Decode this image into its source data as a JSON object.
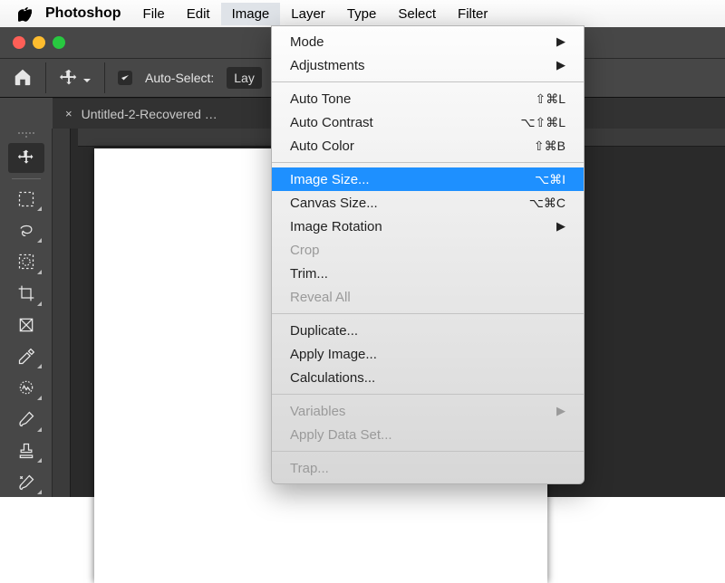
{
  "menubar": {
    "appname": "Photoshop",
    "items": [
      "File",
      "Edit",
      "Image",
      "Layer",
      "Type",
      "Select",
      "Filter"
    ],
    "open_index": 2
  },
  "toolbar": {
    "auto_select_label": "Auto-Select:",
    "layer_label": "Lay"
  },
  "tab": {
    "title": "Untitled-2-Recovered …"
  },
  "dropdown": {
    "groups": [
      [
        {
          "label": "Mode",
          "submenu": true
        },
        {
          "label": "Adjustments",
          "submenu": true
        }
      ],
      [
        {
          "label": "Auto Tone",
          "shortcut": "⇧⌘L"
        },
        {
          "label": "Auto Contrast",
          "shortcut": "⌥⇧⌘L"
        },
        {
          "label": "Auto Color",
          "shortcut": "⇧⌘B"
        }
      ],
      [
        {
          "label": "Image Size...",
          "shortcut": "⌥⌘I",
          "highlight": true
        },
        {
          "label": "Canvas Size...",
          "shortcut": "⌥⌘C"
        },
        {
          "label": "Image Rotation",
          "submenu": true
        },
        {
          "label": "Crop",
          "disabled": true
        },
        {
          "label": "Trim..."
        },
        {
          "label": "Reveal All",
          "disabled": true
        }
      ],
      [
        {
          "label": "Duplicate..."
        },
        {
          "label": "Apply Image..."
        },
        {
          "label": "Calculations..."
        }
      ],
      [
        {
          "label": "Variables",
          "submenu": true,
          "disabled": true
        },
        {
          "label": "Apply Data Set...",
          "disabled": true
        }
      ],
      [
        {
          "label": "Trap...",
          "disabled": true
        }
      ]
    ]
  },
  "tools": [
    {
      "name": "move-tool",
      "active": true
    },
    {
      "name": "marquee-tool"
    },
    {
      "name": "lasso-tool"
    },
    {
      "name": "quick-select-tool"
    },
    {
      "name": "crop-tool"
    },
    {
      "name": "frame-tool"
    },
    {
      "name": "eyedropper-tool"
    },
    {
      "name": "spot-heal-tool"
    },
    {
      "name": "brush-tool"
    },
    {
      "name": "stamp-tool"
    },
    {
      "name": "history-brush-tool"
    }
  ]
}
